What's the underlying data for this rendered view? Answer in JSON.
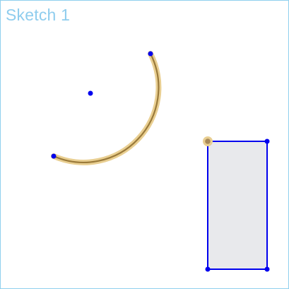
{
  "sketch": {
    "title": "Sketch 1"
  },
  "colors": {
    "frame_border": "#8fd0ee",
    "title_text": "#8fcdee",
    "constraint_blue": "#0000ee",
    "arc_highlight_outer": "#e9cf92",
    "arc_highlight_inner": "#9a7a3a",
    "selected_point_fill": "#a88a5a",
    "selected_point_halo": "#e9cf92",
    "rectangle_fill": "#e8e9ec"
  }
}
